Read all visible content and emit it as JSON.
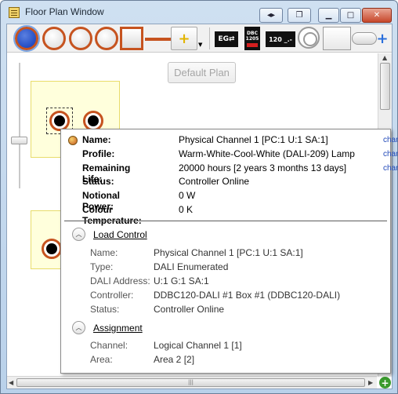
{
  "window": {
    "title": "Floor Plan Window",
    "buttons": {
      "back_fwd": "◂▸",
      "restore_icon": "❐",
      "minimize": "▁",
      "maximize": "□",
      "close": "✕"
    }
  },
  "toolbar": {
    "eg_label": "EG⇄",
    "dbc_label": "DBC 1205",
    "t120_label": "120 _.-",
    "add_yellow": "+",
    "add_blue": "+",
    "dropdown": "▼"
  },
  "canvas": {
    "default_plan_label": "Default Plan"
  },
  "scrollbars": {
    "up": "▲",
    "down": "▼",
    "left": "◀",
    "right": "▶",
    "grip": "|||",
    "corner": "+"
  },
  "tooltip": {
    "header": [
      {
        "label": "Name:",
        "value": "Physical Channel 1 [PC:1 U:1 SA:1]",
        "action": "change"
      },
      {
        "label": "Profile:",
        "value": "Warm-White-Cool-White (DALI-209) Lamp",
        "action": "change"
      },
      {
        "label": "Remaining Life:",
        "value": "20000 hours [2 years 3 months 13 days]",
        "action": "change"
      },
      {
        "label": "Status:",
        "value": "Controller Online",
        "action": ""
      },
      {
        "label": "Notional Power:",
        "value": "0 W",
        "action": ""
      },
      {
        "label": "Colour Temperature:",
        "value": "0 K",
        "action": ""
      }
    ],
    "load_control": {
      "title": "Load Control",
      "toggle": "︿",
      "rows": [
        {
          "label": "Name:",
          "value": "Physical Channel 1 [PC:1 U:1 SA:1]"
        },
        {
          "label": "Type:",
          "value": "DALI Enumerated"
        },
        {
          "label": "DALI Address:",
          "value": "U:1 G:1 SA:1"
        },
        {
          "label": "Controller:",
          "value": "DDBC120-DALI #1 Box #1 (DDBC120-DALI)"
        },
        {
          "label": "Status:",
          "value": "Controller Online"
        }
      ]
    },
    "assignment": {
      "title": "Assignment",
      "toggle": "︿",
      "rows": [
        {
          "label": "Channel:",
          "value": "Logical Channel 1 [1]"
        },
        {
          "label": "Area:",
          "value": "Area 2 [2]"
        }
      ]
    }
  }
}
